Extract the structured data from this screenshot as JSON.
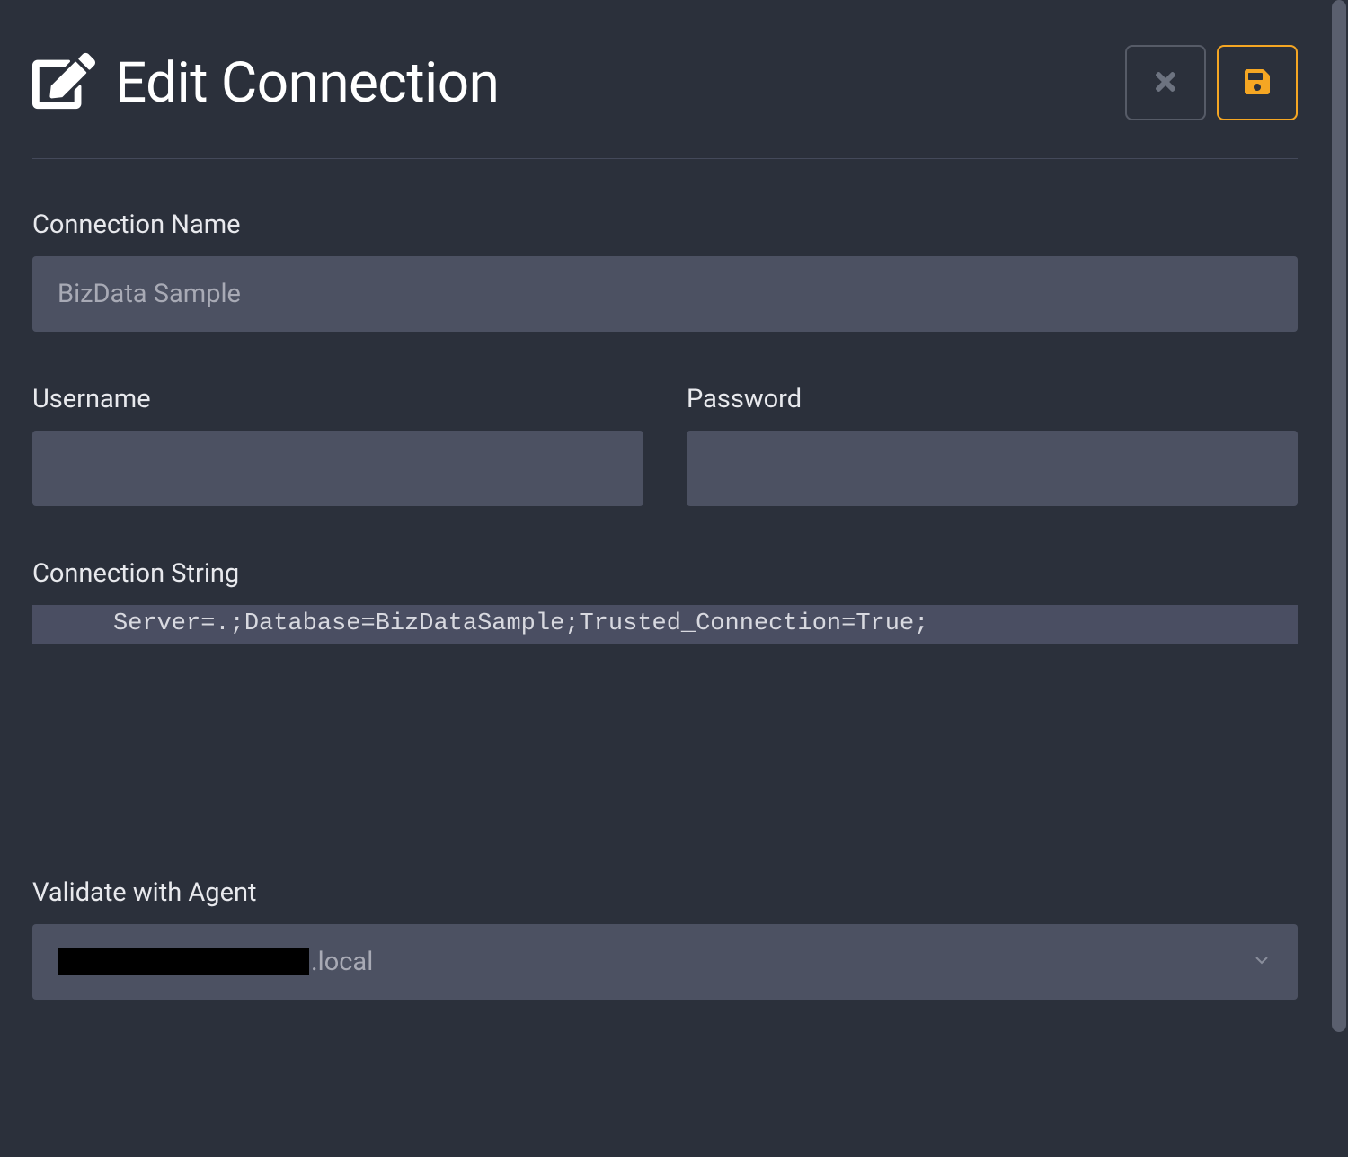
{
  "header": {
    "title": "Edit Connection",
    "icons": {
      "edit": "edit-icon",
      "cancel": "close-icon",
      "save": "save-icon"
    }
  },
  "form": {
    "connection_name": {
      "label": "Connection Name",
      "value": "BizData Sample"
    },
    "username": {
      "label": "Username",
      "value": ""
    },
    "password": {
      "label": "Password",
      "value": ""
    },
    "connection_string": {
      "label": "Connection String",
      "value": "Server=.;Database=BizDataSample;Trusted_Connection=True;"
    },
    "validate_agent": {
      "label": "Validate with Agent",
      "selected_suffix": ".local"
    }
  },
  "colors": {
    "accent": "#f5a623",
    "background": "#2b303b",
    "input_bg": "#4c5162"
  }
}
